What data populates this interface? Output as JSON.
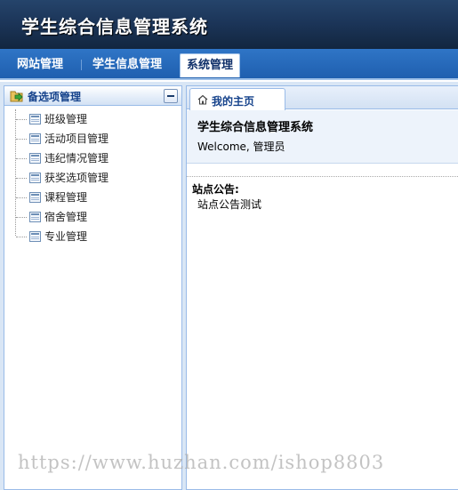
{
  "header": {
    "title": "学生综合信息管理系统"
  },
  "nav": {
    "items": [
      {
        "label": "网站管理"
      },
      {
        "label": "学生信息管理"
      },
      {
        "label": "系统管理",
        "active": true
      }
    ]
  },
  "left_panel": {
    "title": "备选项管理",
    "items": [
      {
        "label": "班级管理"
      },
      {
        "label": "活动项目管理"
      },
      {
        "label": "违纪情况管理"
      },
      {
        "label": "获奖选项管理"
      },
      {
        "label": "课程管理"
      },
      {
        "label": "宿舍管理"
      },
      {
        "label": "专业管理"
      }
    ]
  },
  "main": {
    "tab_label": "我的主页",
    "site_title": "学生综合信息管理系统",
    "welcome": "Welcome, 管理员",
    "notice_label": "站点公告:",
    "notice_text": "站点公告测试"
  },
  "watermark": "https://www.huzhan.com/ishop8803",
  "colors": {
    "header_bg": "#1b3457",
    "nav_bg": "#2466b8",
    "panel_border": "#99bbe8",
    "panel_title": "#15428b"
  },
  "icons": {
    "panel": "folder-arrow-icon",
    "tree_item": "table-icon",
    "tab": "home-icon",
    "collapse": "minus-icon"
  }
}
